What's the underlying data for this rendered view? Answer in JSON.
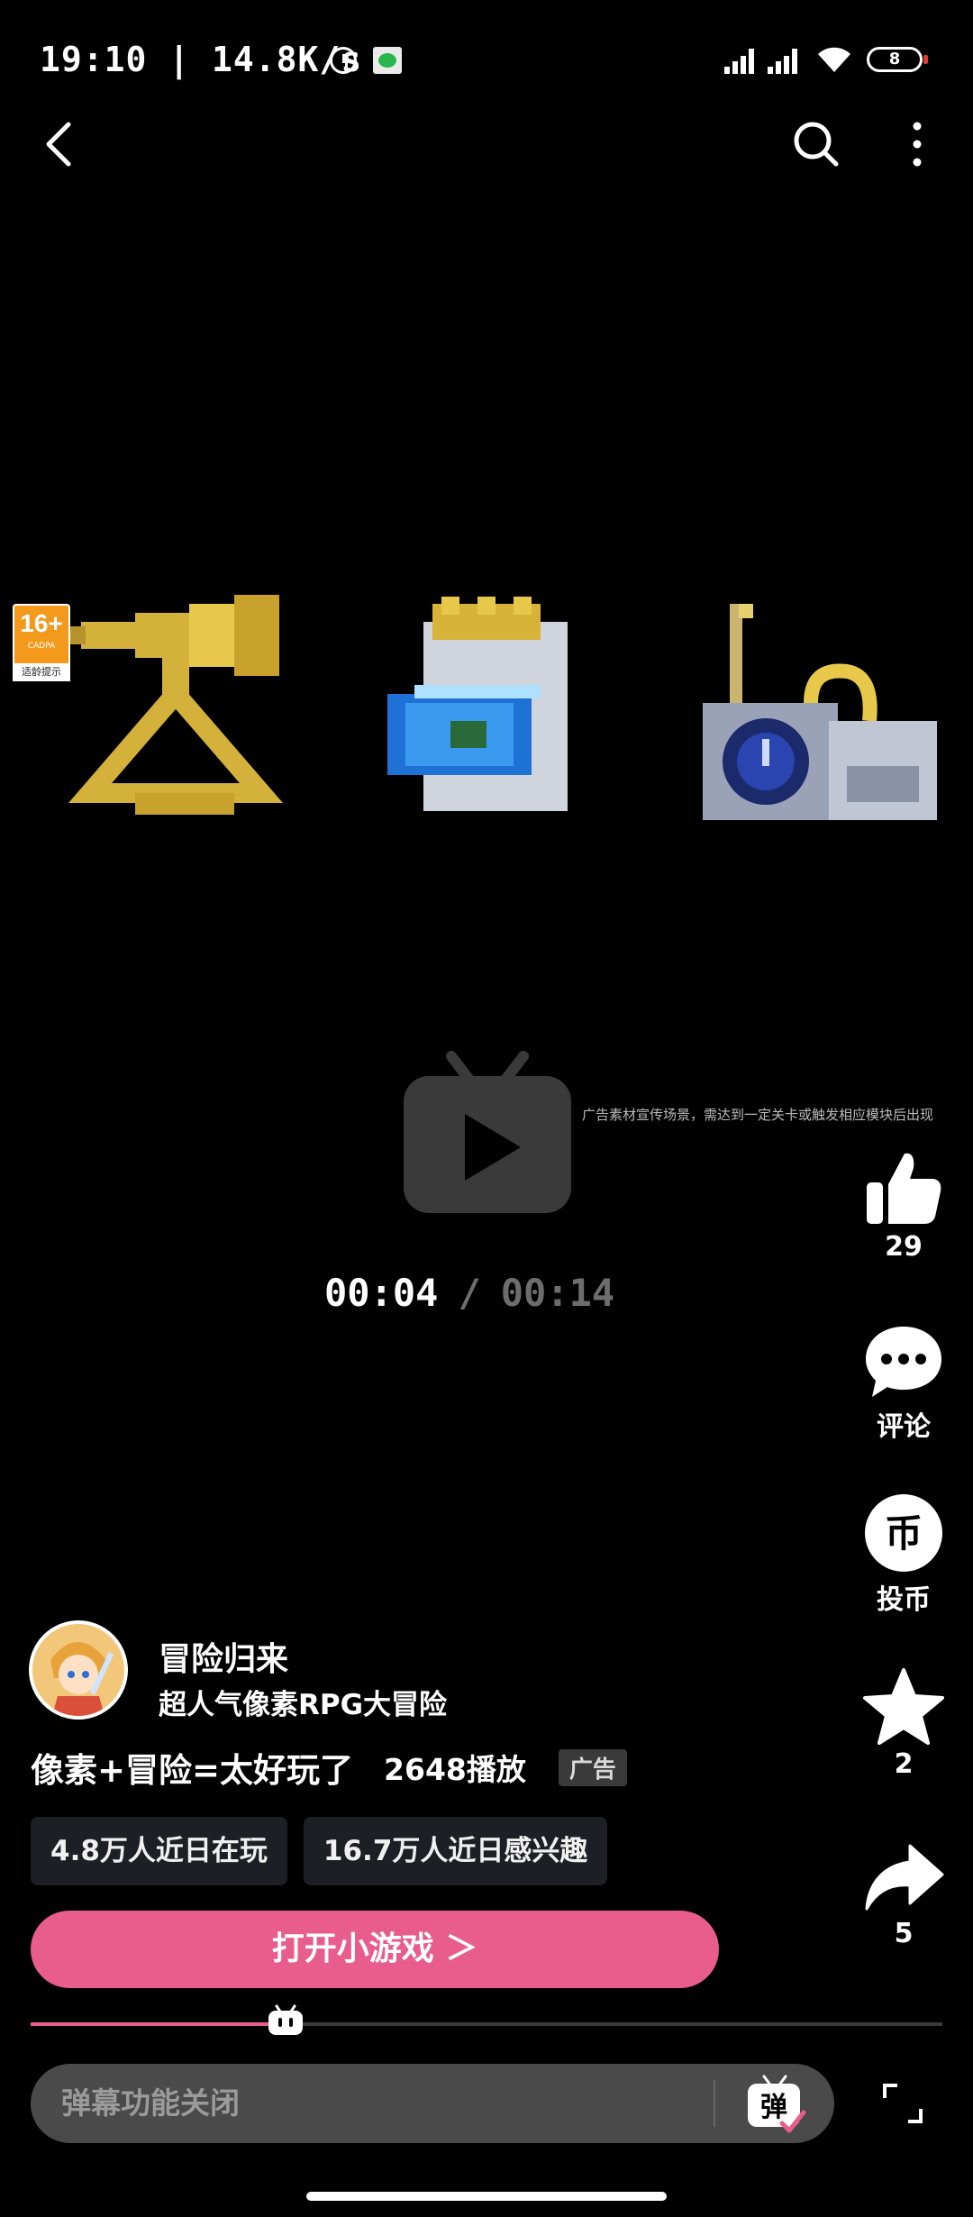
{
  "status_bar": {
    "time": "19:10",
    "speed": "14.8K/s",
    "battery": "8"
  },
  "video": {
    "age_rating": "16+",
    "age_org": "CADPA",
    "age_tip": "适龄提示",
    "ad_note": "广告素材宣传场景，需达到一定关卡或触发相应模块后出现",
    "current_time": "00:04",
    "separator": "/",
    "total_time": "00:14",
    "progress": 0.28
  },
  "actions": {
    "like_count": "29",
    "comment_label": "评论",
    "coin_label": "投币",
    "favorite_count": "2",
    "share_count": "5"
  },
  "info": {
    "author": "冒险归来",
    "subtitle": "超人气像素RPG大冒险",
    "title": "像素+冒险=太好玩了",
    "plays": "2648播放",
    "ad_tag": "广告",
    "chips": [
      "4.8万人近日在玩",
      "16.7万人近日感兴趣"
    ],
    "open_button": "打开小游戏 ＞"
  },
  "danmaku": {
    "placeholder": "弹幕功能关闭",
    "toggle_label": "弹"
  },
  "colors": {
    "accent": "#e85d8b",
    "background": "#000000"
  }
}
